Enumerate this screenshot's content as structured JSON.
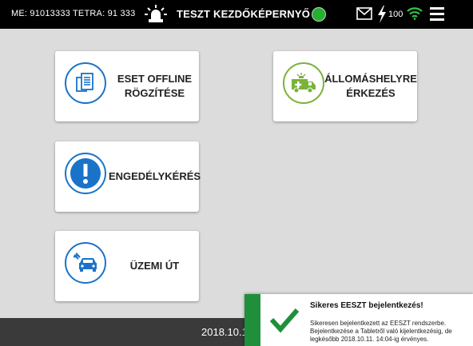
{
  "topbar": {
    "me_label": "ME:  91013333  TETRA:  91 333",
    "title": "TESZT KEZDŐKÉPERNYŐ",
    "battery": "100",
    "icons": [
      "siren-icon",
      "status-dot",
      "mail-icon",
      "bolt-icon",
      "wifi-icon",
      "menu-icon"
    ],
    "status_color": "#25b02f"
  },
  "cards": {
    "eset": "ESET OFFLINE\nRÖGZÍTÉSE",
    "allomas": "ÁLLOMÁSHELYRE\nÉRKEZÉS",
    "engedely": "ENGEDÉLYKÉRÉS",
    "uzemi": "ÜZEMI ÚT"
  },
  "bottombar": {
    "date": "2018.10.1"
  },
  "toast": {
    "title": "Sikeres EESZT bejelentkezés!",
    "body": "Sikeresen bejelentkezett az EESZT rendszerbe. Bejelentkezése a Tabletről való kijelentkezésig, de legkésőbb 2018.10.11. 14:04-ig érvényes.",
    "accent": "#1f8f3c"
  },
  "colors": {
    "blue_accent": "#1a73c8",
    "green_accent": "#7bb23a"
  }
}
